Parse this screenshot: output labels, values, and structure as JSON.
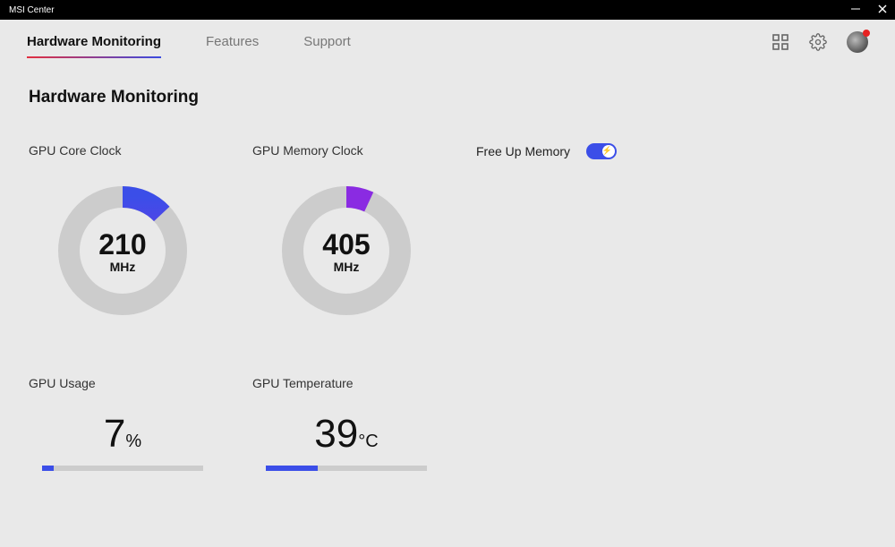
{
  "app_title": "MSI Center",
  "nav": {
    "tabs": [
      {
        "label": "Hardware Monitoring",
        "active": true
      },
      {
        "label": "Features",
        "active": false
      },
      {
        "label": "Support",
        "active": false
      }
    ]
  },
  "page": {
    "title": "Hardware Monitoring"
  },
  "stats": {
    "gpu_core_clock": {
      "label": "GPU Core Clock",
      "value": "210",
      "unit": "MHz",
      "percent": 13
    },
    "gpu_memory_clock": {
      "label": "GPU Memory Clock",
      "value": "405",
      "unit": "MHz",
      "percent": 7
    },
    "free_up_memory": {
      "label": "Free Up Memory",
      "enabled": true
    },
    "gpu_usage": {
      "label": "GPU Usage",
      "value": "7",
      "unit": "%",
      "percent": 7
    },
    "gpu_temperature": {
      "label": "GPU Temperature",
      "value": "39",
      "unit": "°C",
      "percent": 32
    }
  }
}
